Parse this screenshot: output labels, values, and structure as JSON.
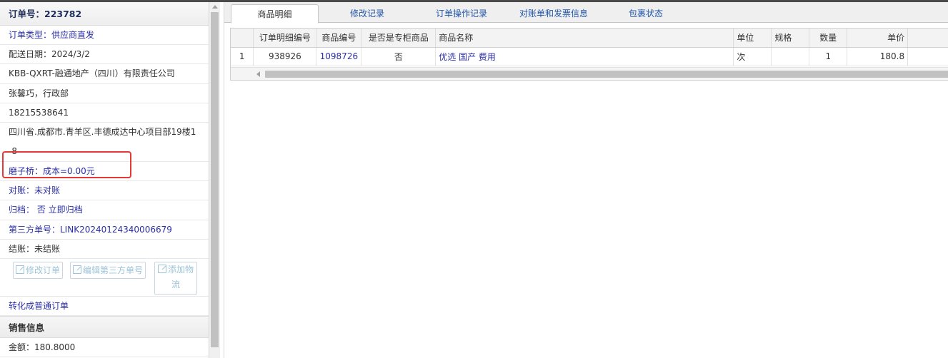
{
  "order": {
    "title": "订单号：223782",
    "rows": [
      "订单类型：供应商直发",
      "配送日期：2024/3/2",
      "KBB-QXRT-融通地产（四川）有限责任公司",
      "张馨巧，行政部",
      "18215538641",
      "四川省.成都市.青羊区.丰德成达中心项目部19楼1-8",
      "磨子桥：成本=0.00元",
      "对账：未对账",
      "归档： 否 立即归档",
      "第三方单号：LINK20240124340006679",
      "结账：未结账"
    ],
    "buttons": {
      "edit_order": "修改订单",
      "edit_third": "编辑第三方单号",
      "add_logistics": "添加物流"
    },
    "convert_link": "转化成普通订单",
    "sales_section": "销售信息",
    "amount": "金额：180.8000"
  },
  "tabs": [
    "商品明细",
    "修改记录",
    "订单操作记录",
    "对账单和发票信息",
    "包裹状态"
  ],
  "grid": {
    "headers": [
      "",
      "订单明细编号",
      "商品编号",
      "是否是专柜商品",
      "商品名称",
      "单位",
      "规格",
      "数量",
      "单价"
    ],
    "rows": [
      [
        "1",
        "938926",
        "1098726",
        "否",
        "优选 国产 费用",
        "次",
        "",
        "1",
        "180.8"
      ]
    ]
  },
  "colors": {
    "link": "#2b2fa6",
    "tab_link": "#2356a8",
    "highlight": "#e53935"
  }
}
